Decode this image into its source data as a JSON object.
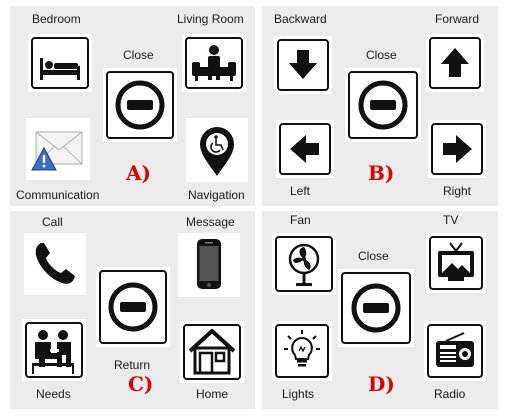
{
  "colors": {
    "panel_bg": "#ebebeb",
    "panel_label": "#e10000",
    "icon": "#111111"
  },
  "panels": {
    "a": {
      "label": "A)",
      "bedroom": "Bedroom",
      "living_room": "Living Room",
      "close": "Close",
      "communication": "Communication",
      "navigation": "Navigation"
    },
    "b": {
      "label": "B)",
      "backward": "Backward",
      "forward": "Forward",
      "close": "Close",
      "left": "Left",
      "right": "Right"
    },
    "c": {
      "label": "C)",
      "call": "Call",
      "message": "Message",
      "return": "Return",
      "needs": "Needs",
      "home": "Home"
    },
    "d": {
      "label": "D)",
      "fan": "Fan",
      "tv": "TV",
      "close": "Close",
      "lights": "Lights",
      "radio": "Radio"
    }
  },
  "icons": {
    "a": [
      "bed-icon",
      "sofa-person-icon",
      "close-icon",
      "envelope-alert-icon",
      "accessible-location-pin-icon"
    ],
    "b": [
      "arrow-down-icon",
      "arrow-up-icon",
      "close-icon",
      "arrow-left-icon",
      "arrow-right-icon"
    ],
    "c": [
      "phone-icon",
      "smartphone-icon",
      "close-icon",
      "people-icon",
      "house-icon"
    ],
    "d": [
      "fan-icon",
      "tv-icon",
      "close-icon",
      "light-bulb-icon",
      "radio-icon"
    ]
  }
}
